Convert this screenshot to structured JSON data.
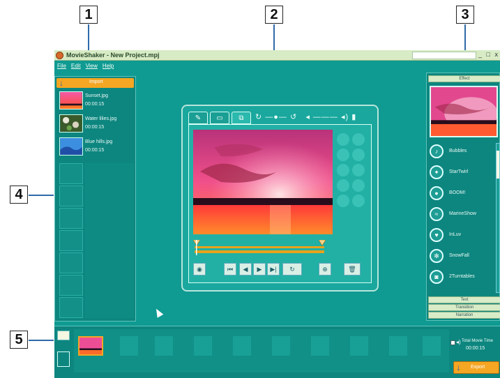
{
  "callouts": {
    "c1": "1",
    "c2": "2",
    "c3": "3",
    "c4": "4",
    "c5": "5"
  },
  "window": {
    "title": "MovieShaker - New Project.mpj",
    "controls": "_ □ x"
  },
  "menu": [
    {
      "label": "File"
    },
    {
      "label": "Edit"
    },
    {
      "label": "View"
    },
    {
      "label": "Help"
    }
  ],
  "import_panel": {
    "header_label": "Import",
    "clips": [
      {
        "name": "Sunset.jpg",
        "duration": "00:00:15"
      },
      {
        "name": "Water lilies.jpg",
        "duration": "00:00:15"
      },
      {
        "name": "Blue hills.jpg",
        "duration": "00:00:15"
      }
    ]
  },
  "effect_panel": {
    "tab_effect": "Effect",
    "tab_text": "Text",
    "tab_transition": "Transition",
    "tab_narration": "Narration",
    "effects": [
      {
        "label": "Bubbles"
      },
      {
        "label": "StarTwirl"
      },
      {
        "label": "BOOM!"
      },
      {
        "label": "MarineShow"
      },
      {
        "label": "InLuv"
      },
      {
        "label": "SnowFall"
      },
      {
        "label": "2Turntables"
      }
    ]
  },
  "storyboard": {
    "total_label": "Total Movie Time",
    "total_value": "00:00:15",
    "export_label": "Export"
  },
  "colors": {
    "app_bg": "#0f9a92",
    "accent": "#f5a623",
    "callout_line": "#2e6aa8"
  }
}
